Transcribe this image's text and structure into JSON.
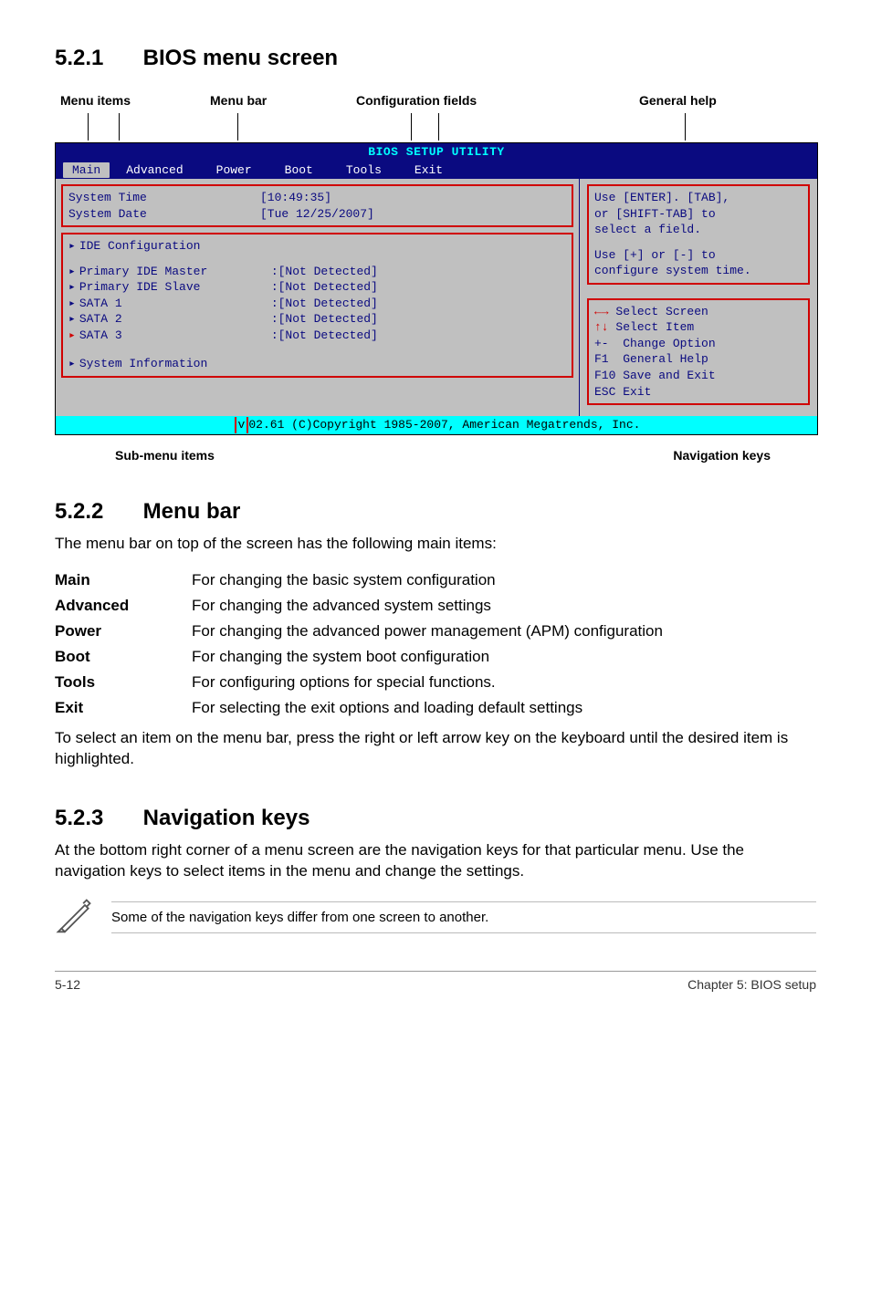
{
  "sections": {
    "s521": {
      "num": "5.2.1",
      "title": "BIOS menu screen"
    },
    "s522": {
      "num": "5.2.2",
      "title": "Menu bar"
    },
    "s523": {
      "num": "5.2.3",
      "title": "Navigation keys"
    }
  },
  "diagram_labels": {
    "menu_items": "Menu items",
    "menu_bar": "Menu bar",
    "config_fields": "Configuration fields",
    "general_help": "General help",
    "sub_menu": "Sub-menu items",
    "nav_keys": "Navigation keys"
  },
  "bios": {
    "title": "BIOS SETUP UTILITY",
    "menubar": [
      "Main",
      "Advanced",
      "Power",
      "Boot",
      "Tools",
      "Exit"
    ],
    "left": {
      "sys_time_k": "System Time",
      "sys_time_v": "[10:49:35]",
      "sys_date_k": "System Date",
      "sys_date_v": "[Tue 12/25/2007]",
      "ide_cfg": "IDE Configuration",
      "pim_k": "Primary IDE Master",
      "pim_v": ":[Not Detected]",
      "pis_k": "Primary IDE Slave",
      "pis_v": ":[Not Detected]",
      "s1_k": "SATA 1",
      "s1_v": ":[Not Detected]",
      "s2_k": "SATA 2",
      "s2_v": ":[Not Detected]",
      "s3_k": "SATA 3",
      "s3_v": ":[Not Detected]",
      "sysinfo": "System Information"
    },
    "right": {
      "l1": "Use [ENTER]. [TAB],",
      "l2": "or [SHIFT-TAB] to",
      "l3": "select a field.",
      "l4": "Use [+] or [-] to",
      "l5": "configure system time.",
      "n1": "Select Screen",
      "n2": "Select Item",
      "n3": "Change Option",
      "n4": "General Help",
      "n5": "F10 Save and Exit",
      "n6": "ESC Exit",
      "k_pm": "+-",
      "k_f1": "F1"
    },
    "footer_pre": "v",
    "footer": "02.61 (C)Copyright 1985-2007, American Megatrends, Inc."
  },
  "s522_intro": "The menu bar on top of the screen has the following main items:",
  "menu_desc": {
    "Main": "For changing the basic system configuration",
    "Advanced": "For changing the advanced system settings",
    "Power": "For changing the advanced power management (APM) configuration",
    "Boot": "For changing the system boot configuration",
    "Tools": "For configuring options for special functions.",
    "Exit": "For selecting the exit options and loading default settings"
  },
  "s522_outro": "To select an item on the menu bar, press the right or left arrow key on the keyboard until the desired item is highlighted.",
  "s523_body": "At the bottom right corner of a menu screen are the navigation keys for that particular menu. Use the navigation keys to select items in the menu and change the settings.",
  "note": "Some of the navigation keys differ from one screen to another.",
  "footer": {
    "page": "5-12",
    "chapter": "Chapter 5: BIOS setup"
  }
}
